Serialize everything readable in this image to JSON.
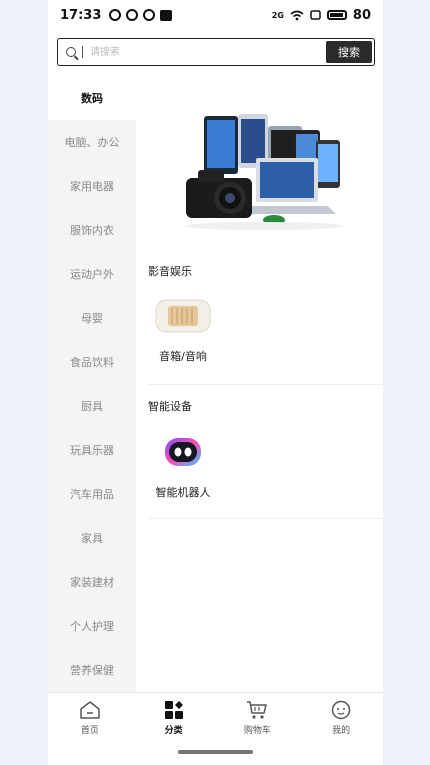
{
  "status": {
    "time": "17:33",
    "battery": "80",
    "network": "2G"
  },
  "search": {
    "placeholder": "请搜索",
    "button": "搜索"
  },
  "sidebar": {
    "items": [
      {
        "label": "数码",
        "active": true
      },
      {
        "label": "电脑、办公"
      },
      {
        "label": "家用电器"
      },
      {
        "label": "服饰内衣"
      },
      {
        "label": "运动户外"
      },
      {
        "label": "母婴"
      },
      {
        "label": "食品饮料"
      },
      {
        "label": "厨具"
      },
      {
        "label": "玩具乐器"
      },
      {
        "label": "汽车用品"
      },
      {
        "label": "家具"
      },
      {
        "label": "家装建材"
      },
      {
        "label": "个人护理"
      },
      {
        "label": "营养保健"
      }
    ]
  },
  "content": {
    "sections": [
      {
        "title": "影音娱乐",
        "items": [
          {
            "label": "音箱/音响",
            "icon": "speaker-icon"
          }
        ]
      },
      {
        "title": "智能设备",
        "items": [
          {
            "label": "智能机器人",
            "icon": "robot-icon"
          }
        ]
      }
    ]
  },
  "tabbar": {
    "tabs": [
      {
        "label": "首页",
        "icon": "home-icon"
      },
      {
        "label": "分类",
        "icon": "category-icon",
        "active": true
      },
      {
        "label": "购物车",
        "icon": "cart-icon"
      },
      {
        "label": "我的",
        "icon": "profile-icon"
      }
    ]
  }
}
